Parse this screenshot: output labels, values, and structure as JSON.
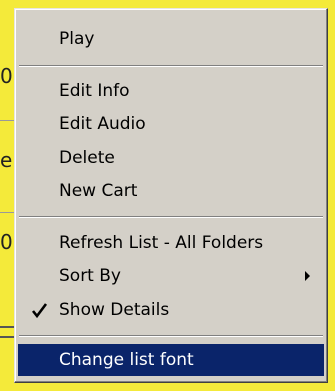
{
  "background": {
    "visible_glyphs": [
      "0",
      "e",
      "0",
      "≡"
    ]
  },
  "menu": {
    "items": {
      "play": {
        "label": "Play"
      },
      "edit_info": {
        "label": "Edit Info"
      },
      "edit_audio": {
        "label": "Edit Audio"
      },
      "delete": {
        "label": "Delete"
      },
      "new_cart": {
        "label": "New Cart"
      },
      "refresh_list": {
        "label": "Refresh List - All Folders"
      },
      "sort_by": {
        "label": "Sort By",
        "has_submenu": true
      },
      "show_details": {
        "label": "Show Details",
        "checked": true
      },
      "change_list_font": {
        "label": "Change list font",
        "highlighted": true
      }
    },
    "colors": {
      "menu_face": "#d4d0c8",
      "highlight": "#0a246a",
      "highlight_text": "#ffffff",
      "backdrop": "#f4ea3a"
    }
  }
}
